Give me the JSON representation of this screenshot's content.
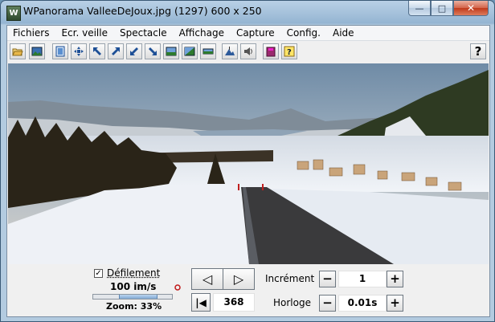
{
  "window": {
    "title": "WPanorama  ValleeDeJoux.jpg   (1297) 600 x 250",
    "app_icon_label": "W",
    "buttons": {
      "minimize": "—",
      "maximize": "□",
      "close": "✕"
    }
  },
  "menu": [
    "Fichiers",
    "Ecr. veille",
    "Spectacle",
    "Affichage",
    "Capture",
    "Config.",
    "Aide"
  ],
  "toolbar": {
    "icons": [
      "open-folder-icon",
      "landscape-image-icon",
      "fit-window-icon",
      "expand-arrows-icon",
      "arrow-upleft-icon",
      "arrow-upright-icon",
      "arrow-downleft-icon",
      "arrow-downright-icon",
      "view-panorama-1-icon",
      "view-panorama-2-icon",
      "view-panorama-3-icon",
      "landscape-mountain-icon",
      "speaker-icon",
      "book-icon",
      "help-pointer-icon"
    ],
    "help_label": "?"
  },
  "image": {
    "name": "ValleeDeJoux.jpg",
    "width": 600,
    "height": 250
  },
  "controls": {
    "scroll_checked": true,
    "scroll_check_mark": "✓",
    "scroll_label": "Défilement",
    "speed": "100 im/s",
    "zoom": "Zoom: 33%",
    "zoom_fraction": 0.33,
    "prev_symbol": "◁",
    "next_symbol": "▷",
    "first_symbol": "|◀",
    "position": "368",
    "increment_label": "Incrément",
    "increment_value": "1",
    "clock_label": "Horloge",
    "clock_value": "0.01s",
    "minus": "−",
    "plus": "+"
  },
  "colors": {
    "sky": "#9eb3c4",
    "snow": "#e8edf4",
    "road": "#3a3a3c",
    "forest": "#2a2418",
    "frame": "#b9d1e6"
  }
}
